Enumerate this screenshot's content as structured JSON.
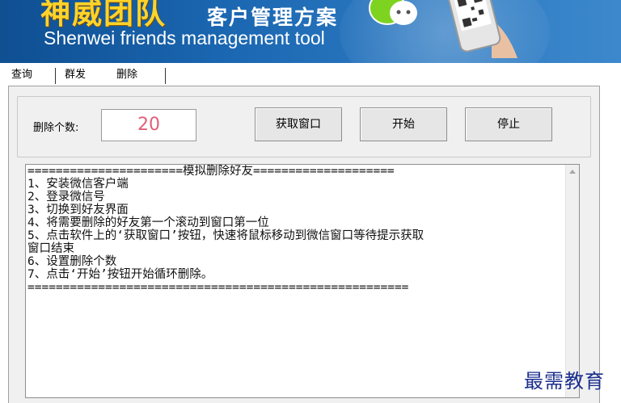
{
  "banner": {
    "title_cn": "神威团队",
    "subtitle_cn": "客户管理方案",
    "title_en": "Shenwei friends management tool"
  },
  "tabs": [
    {
      "label": "查询"
    },
    {
      "label": "群发"
    },
    {
      "label": "删除",
      "active": true
    }
  ],
  "form": {
    "count_label": "删除个数:",
    "count_value": "20",
    "buttons": {
      "get_window": "获取窗口",
      "start": "开始",
      "stop": "停止"
    }
  },
  "log": {
    "lines": [
      "======================模拟删除好友====================",
      "1、安装微信客户端",
      "2、登录微信号",
      "3、切换到好友界面",
      "4、将需要删除的好友第一个滚动到窗口第一位",
      "5、点击软件上的‘获取窗口’按钮，快速将鼠标移动到微信窗口等待提示获取",
      "窗口结束",
      "6、设置删除个数",
      "7、点击‘开始’按钮开始循环删除。",
      "======================================================"
    ]
  },
  "watermark": "最需教育",
  "colors": {
    "banner_blue": "#1a66b0",
    "title_yellow": "#ffd32a",
    "count_text": "#e0607a",
    "watermark": "#1b2f8f"
  }
}
